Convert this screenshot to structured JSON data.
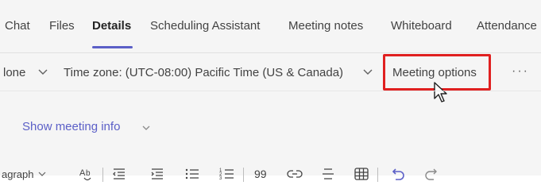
{
  "tabs": [
    {
      "label": "Chat",
      "active": false
    },
    {
      "label": "Files",
      "active": false
    },
    {
      "label": "Details",
      "active": true
    },
    {
      "label": "Scheduling Assistant",
      "active": false
    },
    {
      "label": "Meeting notes",
      "active": false
    },
    {
      "label": "Whiteboard",
      "active": false
    },
    {
      "label": "Attendance",
      "active": false
    }
  ],
  "toolbar": {
    "prev_item_fragment": "lone",
    "timezone_label": "Time zone: (UTC-08:00) Pacific Time (US & Canada)",
    "meeting_options_label": "Meeting options",
    "more_label": "···"
  },
  "show_info": {
    "label": "Show meeting info"
  },
  "editor": {
    "paragraph_fragment": "agraph",
    "quote_label": "99"
  },
  "colors": {
    "accent": "#5b5fc7",
    "highlight_box": "#e02020"
  }
}
